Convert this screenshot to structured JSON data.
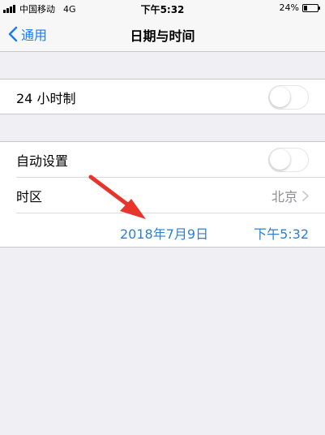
{
  "status_bar": {
    "carrier": "中国移动",
    "network": "4G",
    "time": "下午5:32",
    "battery_percent_text": "24%",
    "battery_level": 0.24
  },
  "nav": {
    "back_label": "通用",
    "title": "日期与时间"
  },
  "settings": {
    "hour24_label": "24 小时制",
    "hour24_on": false,
    "auto_set_label": "自动设置",
    "auto_set_on": false,
    "timezone_label": "时区",
    "timezone_value": "北京",
    "date_value": "2018年7月9日",
    "time_value": "下午5:32"
  },
  "colors": {
    "accent": "#1a7cf5",
    "annotation_arrow": "#e8352b"
  }
}
